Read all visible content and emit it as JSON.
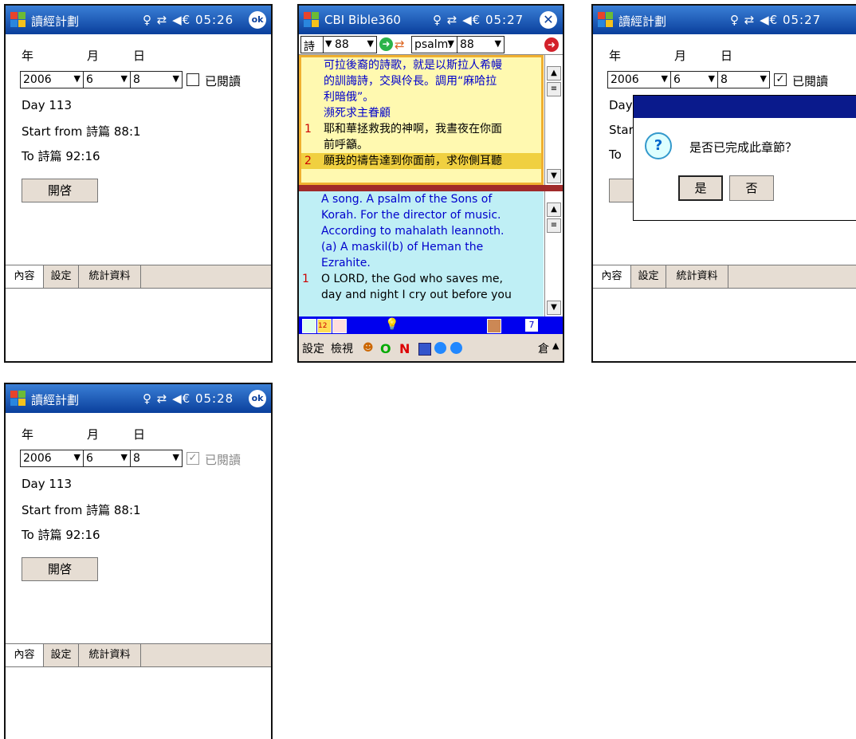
{
  "screen1": {
    "title": "讀經計劃",
    "status": "♀ ⇄ ◀€ 05:26",
    "ok_label": "ok",
    "labels": {
      "year": "年",
      "month": "月",
      "day": "日"
    },
    "year": "2006",
    "month": "6",
    "dayval": "8",
    "read_label": "已閱讀",
    "day_text": "Day 113",
    "start_text": "Start from 詩篇 88:1",
    "to_text": "To 詩篇 92:16",
    "open_label": "開啓",
    "tabs": [
      "內容",
      "設定",
      "統計資料"
    ]
  },
  "screen2": {
    "title": "CBI Bible360",
    "status": "♀ ⇄ ◀€ 05:27",
    "book_cn": "詩",
    "chap1": "88",
    "book_en": "psalm:",
    "chap2": "88",
    "zh": {
      "intro": [
        "可拉後裔的詩歌，就是以斯拉人希幔",
        "的訓誨詩，交與伶長。調用“麻哈拉",
        "利暗俄”。"
      ],
      "heading": "瀕死求主眷顧",
      "v1_num": "1",
      "v1": [
        "耶和華拯救我的神啊，我晝夜在你面",
        "前呼籲。"
      ],
      "v2_num": "2",
      "v2": "願我的禱告達到你面前，求你側耳聽"
    },
    "en": {
      "intro": [
        "A song. A psalm of the Sons of",
        "Korah. For the director of music.",
        "According to mahalath leannoth.",
        "(a) A maskil(b) of Heman the",
        "Ezrahite."
      ],
      "v1_num": "1",
      "v1": [
        "O LORD, the God who saves me,",
        "day and night I cry out before you"
      ]
    },
    "toolbar_num": "7",
    "bottom": {
      "settings": "設定",
      "view": "檢視",
      "o_label": "O",
      "n_label": "N",
      "kb": "倉"
    }
  },
  "screen3": {
    "title": "讀經計劃",
    "status": "♀ ⇄ ◀€ 05:27",
    "labels": {
      "year": "年",
      "month": "月",
      "day": "日"
    },
    "year": "2006",
    "month": "6",
    "dayval": "8",
    "read_label": "已閱讀",
    "day_frag": "Day",
    "start_frag": "Star",
    "to_frag": "To",
    "dialog_q": "是否已完成此章節？",
    "yes": "是",
    "no": "否",
    "tabs": [
      "內容",
      "設定",
      "統計資料"
    ]
  },
  "screen4": {
    "title": "讀經計劃",
    "status": "♀ ⇄ ◀€ 05:28",
    "ok_label": "ok",
    "labels": {
      "year": "年",
      "month": "月",
      "day": "日"
    },
    "year": "2006",
    "month": "6",
    "dayval": "8",
    "read_label": "已閱讀",
    "day_text": "Day 113",
    "start_text": "Start from 詩篇 88:1",
    "to_text": "To 詩篇 92:16",
    "open_label": "開啓",
    "tabs": [
      "內容",
      "設定",
      "統計資料"
    ]
  },
  "colors": {
    "title_blue": "#0a3f9c",
    "tab_bg": "#e6ddd3",
    "zh_pane": "#fff9b0",
    "en_pane": "#bfeff5",
    "toolbar_blue": "#0000ee"
  }
}
